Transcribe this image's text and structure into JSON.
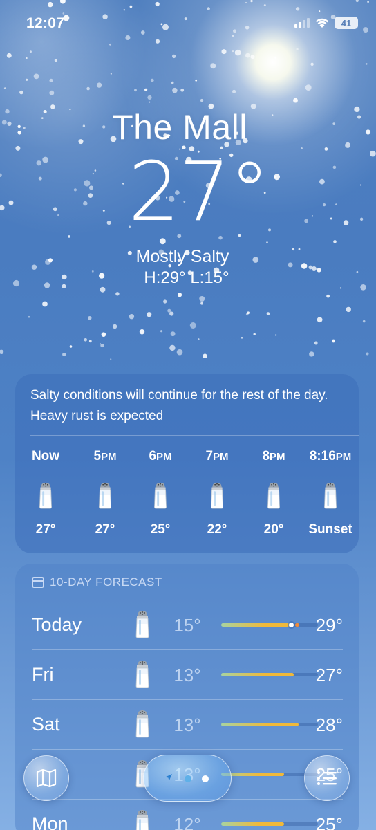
{
  "status_bar": {
    "time": "12:07",
    "battery": "41"
  },
  "location": {
    "name": "The Mall",
    "temperature": "27°",
    "condition": "Mostly Salty",
    "high_low": "H:29°  L:15°"
  },
  "hourly": {
    "summary": "Salty conditions will continue for the rest of the day. Heavy rust is expected",
    "items": [
      {
        "time": "Now",
        "temp": "27°",
        "icon": "salt-shaker-icon"
      },
      {
        "time": "5",
        "suffix": "PM",
        "temp": "27°",
        "icon": "salt-shaker-icon"
      },
      {
        "time": "6",
        "suffix": "PM",
        "temp": "25°",
        "icon": "salt-shaker-icon"
      },
      {
        "time": "7",
        "suffix": "PM",
        "temp": "22°",
        "icon": "salt-shaker-icon"
      },
      {
        "time": "8",
        "suffix": "PM",
        "temp": "20°",
        "icon": "salt-shaker-icon"
      },
      {
        "time": "8:16",
        "suffix": "PM",
        "temp": "Sunset",
        "icon": "salt-shaker-icon"
      }
    ]
  },
  "forecast": {
    "header": "10-DAY FORECAST",
    "days": [
      {
        "day": "Today",
        "low": "15°",
        "high": "29°",
        "icon": "salt-shaker-icon",
        "bar_start": 0.0,
        "bar_end": 0.75,
        "current_marker": 0.72
      },
      {
        "day": "Fri",
        "low": "13°",
        "high": "27°",
        "icon": "salt-shaker-icon",
        "bar_start": 0.0,
        "bar_end": 0.75
      },
      {
        "day": "Sat",
        "low": "13°",
        "high": "28°",
        "icon": "salt-shaker-icon",
        "bar_start": 0.0,
        "bar_end": 0.8
      },
      {
        "day": "",
        "low": "13°",
        "high": "25°",
        "icon": "salt-shaker-icon",
        "bar_start": 0.0,
        "bar_end": 0.65
      },
      {
        "day": "Mon",
        "low": "12°",
        "high": "25°",
        "icon": "salt-shaker-icon",
        "bar_start": 0.0,
        "bar_end": 0.65
      }
    ]
  },
  "controls": {
    "map_icon": "map-icon",
    "list_icon": "list-icon",
    "nav_icon": "location-arrow-icon"
  },
  "colors": {
    "bar_cool": "#a8d3a0",
    "bar_warm": "#f0b93a",
    "bar_hot": "#f08a3a",
    "page_dot_active": "#ffffff",
    "page_dot_inactive": "#5fb0e8"
  }
}
